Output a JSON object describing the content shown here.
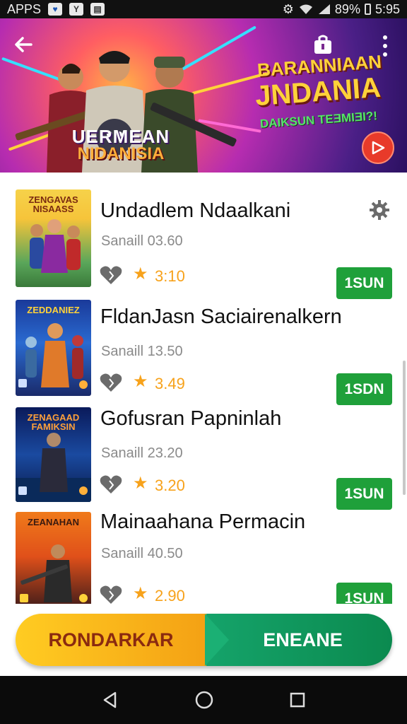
{
  "status_bar": {
    "apps_label": "APPS",
    "battery": "89%",
    "time": "5:95"
  },
  "banner": {
    "title_line1": "BARANNIAAN",
    "title_line2": "JNDANIA",
    "subtitle": "DAIKSUN TEƎMIƎI?!",
    "logo_line1": "UERMEAN",
    "logo_line2": "NIDANISIA"
  },
  "items": [
    {
      "thumb_title": "ZENGAVAS NISAASS",
      "title": "Undadlem Ndaalkani",
      "subtitle": "Sanaill 03.60",
      "rating": "3:10",
      "button": "1SUN"
    },
    {
      "thumb_title": "ZEDDANIEZ",
      "title": "FldanJasn Saciairenalkern",
      "subtitle": "Sanaill 13.50",
      "rating": "3.49",
      "button": "1SDN"
    },
    {
      "thumb_title": "ZENAGAAD FAMIKSIN",
      "title": "Gofusran Papninlah",
      "subtitle": "Sanaill 23.20",
      "rating": "3.20",
      "button": "1SUN"
    },
    {
      "thumb_title": "ZEANAHAN",
      "title": "Mainaahana Permacin",
      "subtitle": "Sanaill 40.50",
      "rating": "2.90",
      "button": "1SUN"
    }
  ],
  "actions": {
    "left": "RONDARKAR",
    "right": "ENEANE"
  },
  "colors": {
    "accent_green": "#1fa03a",
    "rating_orange": "#f7a21b",
    "banner_purple": "#6a1f86"
  }
}
